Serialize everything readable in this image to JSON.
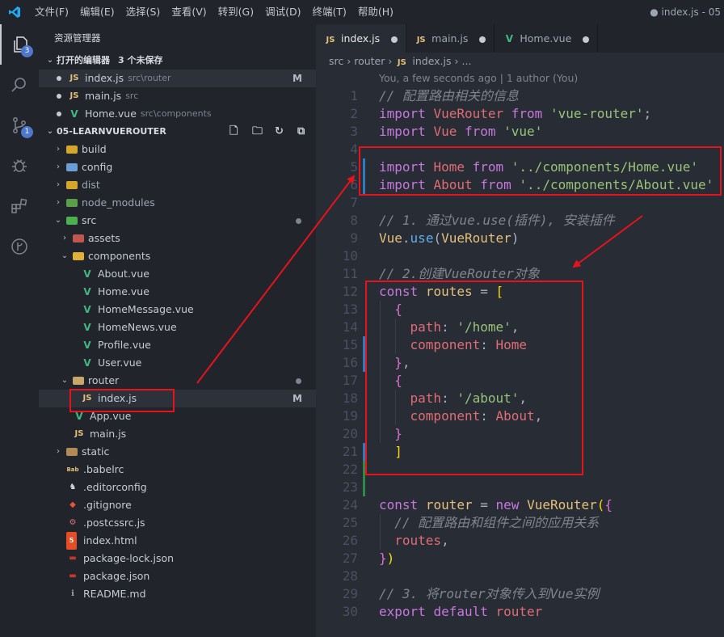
{
  "titlebar": {
    "menus": [
      "文件(F)",
      "编辑(E)",
      "选择(S)",
      "查看(V)",
      "转到(G)",
      "调试(D)",
      "终端(T)",
      "帮助(H)"
    ],
    "window_title": "● index.js - 05"
  },
  "activity": {
    "explorer_badge": "3",
    "scm_badge": "1"
  },
  "sidebar": {
    "title": "资源管理器",
    "open_editors_label": "打开的编辑器",
    "open_editors_count": "3 个未保存",
    "open_editors": [
      {
        "icon": "JS",
        "name": "index.js",
        "desc": "src\\router",
        "status": "M"
      },
      {
        "icon": "JS",
        "name": "main.js",
        "desc": "src",
        "status": ""
      },
      {
        "icon": "V",
        "name": "Home.vue",
        "desc": "src\\components",
        "status": ""
      }
    ],
    "project_label": "05-LEARNVUEROUTER",
    "tree": {
      "build": "build",
      "config": "config",
      "dist": "dist",
      "node_modules": "node_modules",
      "src": "src",
      "assets": "assets",
      "components": "components",
      "about": "About.vue",
      "home": "Home.vue",
      "home_message": "HomeMessage.vue",
      "home_news": "HomeNews.vue",
      "profile": "Profile.vue",
      "user": "User.vue",
      "router": "router",
      "index_js": "index.js",
      "index_js_status": "M",
      "app_vue": "App.vue",
      "main_js": "main.js",
      "static": "static",
      "babelrc": ".babelrc",
      "editorconfig": ".editorconfig",
      "gitignore": ".gitignore",
      "postcssrc": ".postcssrc.js",
      "index_html": "index.html",
      "package_lock": "package-lock.json",
      "package_json": "package.json",
      "readme": "README.md"
    }
  },
  "tabs": [
    {
      "icon": "JS",
      "name": "index.js"
    },
    {
      "icon": "JS",
      "name": "main.js"
    },
    {
      "icon": "V",
      "name": "Home.vue"
    }
  ],
  "breadcrumb": {
    "part1": "src",
    "part2": "router",
    "icon": "JS",
    "part3": "index.js",
    "part4": "..."
  },
  "codelens": "You, a few seconds ago | 1 author (You)",
  "code": {
    "lines": [
      {
        "n": "1",
        "tokens": [
          [
            "cm",
            "// 配置路由相关的信息"
          ]
        ]
      },
      {
        "n": "2",
        "tokens": [
          [
            "kw",
            "import"
          ],
          [
            "pl",
            " "
          ],
          [
            "var",
            "VueRouter"
          ],
          [
            "pl",
            " "
          ],
          [
            "kw",
            "from"
          ],
          [
            "pl",
            " "
          ],
          [
            "str",
            "'vue-router'"
          ],
          [
            "pl",
            ";"
          ]
        ]
      },
      {
        "n": "3",
        "tokens": [
          [
            "kw",
            "import"
          ],
          [
            "pl",
            " "
          ],
          [
            "var",
            "Vue"
          ],
          [
            "pl",
            " "
          ],
          [
            "kw",
            "from"
          ],
          [
            "pl",
            " "
          ],
          [
            "str",
            "'vue'"
          ]
        ]
      },
      {
        "n": "4",
        "tokens": []
      },
      {
        "n": "5",
        "tokens": [
          [
            "kw",
            "import"
          ],
          [
            "pl",
            " "
          ],
          [
            "var",
            "Home"
          ],
          [
            "pl",
            " "
          ],
          [
            "kw",
            "from"
          ],
          [
            "pl",
            " "
          ],
          [
            "str",
            "'../components/Home.vue'"
          ]
        ]
      },
      {
        "n": "6",
        "tokens": [
          [
            "kw",
            "import"
          ],
          [
            "pl",
            " "
          ],
          [
            "var",
            "About"
          ],
          [
            "pl",
            " "
          ],
          [
            "kw",
            "from"
          ],
          [
            "pl",
            " "
          ],
          [
            "str",
            "'../components/About.vue'"
          ]
        ]
      },
      {
        "n": "7",
        "tokens": []
      },
      {
        "n": "8",
        "tokens": [
          [
            "cm",
            "// 1. 通过vue.use(插件), 安装插件"
          ]
        ]
      },
      {
        "n": "9",
        "tokens": [
          [
            "cls",
            "Vue"
          ],
          [
            "pl",
            "."
          ],
          [
            "fn",
            "use"
          ],
          [
            "pl",
            "("
          ],
          [
            "cls",
            "VueRouter"
          ],
          [
            "pl",
            ")"
          ]
        ]
      },
      {
        "n": "10",
        "tokens": []
      },
      {
        "n": "11",
        "tokens": [
          [
            "cm",
            "// 2.创建VueRouter对象"
          ]
        ]
      },
      {
        "n": "12",
        "tokens": [
          [
            "kw",
            "const"
          ],
          [
            "pl",
            " "
          ],
          [
            "cls",
            "routes"
          ],
          [
            "pl",
            " = "
          ],
          [
            "br1",
            "["
          ]
        ]
      },
      {
        "n": "13",
        "tokens": [
          [
            "pl",
            "  "
          ],
          [
            "br2",
            "{"
          ]
        ]
      },
      {
        "n": "14",
        "tokens": [
          [
            "pl",
            "    "
          ],
          [
            "var",
            "path"
          ],
          [
            "pl",
            ": "
          ],
          [
            "str",
            "'/home'"
          ],
          [
            "pl",
            ","
          ]
        ]
      },
      {
        "n": "15",
        "tokens": [
          [
            "pl",
            "    "
          ],
          [
            "var",
            "component"
          ],
          [
            "pl",
            ": "
          ],
          [
            "var",
            "Home"
          ]
        ]
      },
      {
        "n": "16",
        "tokens": [
          [
            "pl",
            "  "
          ],
          [
            "br2",
            "}"
          ],
          [
            "pl",
            ","
          ]
        ]
      },
      {
        "n": "17",
        "tokens": [
          [
            "pl",
            "  "
          ],
          [
            "br2",
            "{"
          ]
        ]
      },
      {
        "n": "18",
        "tokens": [
          [
            "pl",
            "    "
          ],
          [
            "var",
            "path"
          ],
          [
            "pl",
            ": "
          ],
          [
            "str",
            "'/about'"
          ],
          [
            "pl",
            ","
          ]
        ]
      },
      {
        "n": "19",
        "tokens": [
          [
            "pl",
            "    "
          ],
          [
            "var",
            "component"
          ],
          [
            "pl",
            ": "
          ],
          [
            "var",
            "About"
          ],
          [
            "pl",
            ","
          ]
        ]
      },
      {
        "n": "20",
        "tokens": [
          [
            "pl",
            "  "
          ],
          [
            "br2",
            "}"
          ]
        ]
      },
      {
        "n": "21",
        "tokens": [
          [
            "pl",
            "  "
          ],
          [
            "br1",
            "]"
          ]
        ]
      },
      {
        "n": "22",
        "tokens": []
      },
      {
        "n": "23",
        "tokens": []
      },
      {
        "n": "24",
        "tokens": [
          [
            "kw",
            "const"
          ],
          [
            "pl",
            " "
          ],
          [
            "cls",
            "router"
          ],
          [
            "pl",
            " = "
          ],
          [
            "kw",
            "new"
          ],
          [
            "pl",
            " "
          ],
          [
            "cls",
            "VueRouter"
          ],
          [
            "br1",
            "("
          ],
          [
            "br2",
            "{"
          ]
        ]
      },
      {
        "n": "25",
        "tokens": [
          [
            "pl",
            "  "
          ],
          [
            "cm",
            "// 配置路由和组件之间的应用关系"
          ]
        ]
      },
      {
        "n": "26",
        "tokens": [
          [
            "pl",
            "  "
          ],
          [
            "var",
            "routes"
          ],
          [
            "pl",
            ","
          ]
        ]
      },
      {
        "n": "27",
        "tokens": [
          [
            "br2",
            "}"
          ],
          [
            "br1",
            ")"
          ]
        ]
      },
      {
        "n": "28",
        "tokens": []
      },
      {
        "n": "29",
        "tokens": [
          [
            "cm",
            "// 3. 将router对象传入到Vue实例"
          ]
        ]
      },
      {
        "n": "30",
        "tokens": [
          [
            "kw",
            "export"
          ],
          [
            "pl",
            " "
          ],
          [
            "kw",
            "default"
          ],
          [
            "pl",
            " "
          ],
          [
            "var",
            "router"
          ]
        ]
      }
    ]
  },
  "colors": {
    "keyword": "#c678dd",
    "string": "#98c379",
    "variable": "#e06c75",
    "annotation_red": "#e8131a",
    "git_modified": "#2e7cbf",
    "git_added": "#2d8a4a"
  }
}
